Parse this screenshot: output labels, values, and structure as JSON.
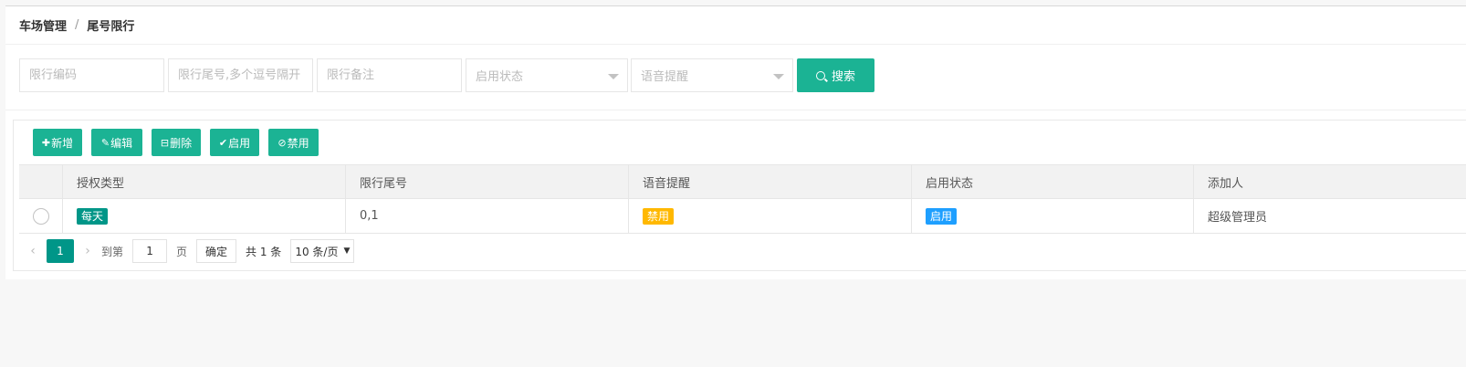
{
  "breadcrumb": {
    "parent": "车场管理",
    "separator": "/",
    "current": "尾号限行"
  },
  "filters": {
    "code_placeholder": "限行编码",
    "tail_placeholder": "限行尾号,多个逗号隔开",
    "remark_placeholder": "限行备注",
    "status_placeholder": "启用状态",
    "voice_placeholder": "语音提醒",
    "search_label": "搜索"
  },
  "toolbar": {
    "add_label": "新增",
    "edit_label": "编辑",
    "delete_label": "删除",
    "enable_label": "启用",
    "disable_label": "禁用"
  },
  "table": {
    "headers": [
      "授权类型",
      "限行尾号",
      "语音提醒",
      "启用状态",
      "添加人"
    ],
    "rows": [
      {
        "auth_type": "每天",
        "tail_numbers": "0,1",
        "voice": "禁用",
        "status": "启用",
        "added_by": "超级管理员"
      }
    ]
  },
  "pager": {
    "current_page": "1",
    "goto_label": "到第",
    "goto_value": "1",
    "page_suffix": "页",
    "confirm_label": "确定",
    "total_label": "共 1 条",
    "page_size": "10 条/页"
  },
  "colors": {
    "primary": "#1bb394",
    "tag_teal": "#009688",
    "tag_warn": "#ffb800",
    "tag_blue": "#1e9fff"
  },
  "icons": {
    "search": "search-icon",
    "add": "plus-icon",
    "edit": "edit-icon",
    "delete": "trash-icon",
    "enable": "check-circle-icon",
    "disable": "ban-icon"
  }
}
